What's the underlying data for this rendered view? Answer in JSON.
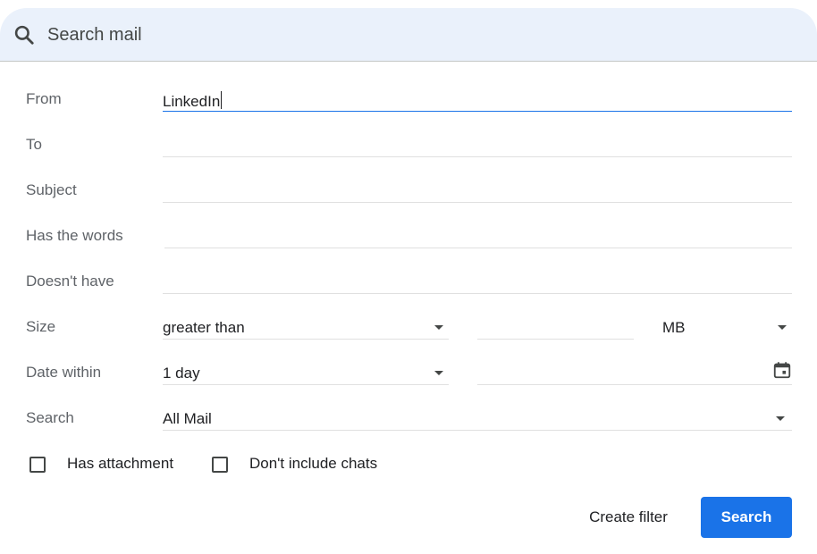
{
  "search": {
    "placeholder": "Search mail"
  },
  "form": {
    "from": {
      "label": "From",
      "value": "LinkedIn"
    },
    "to": {
      "label": "To",
      "value": ""
    },
    "subject": {
      "label": "Subject",
      "value": ""
    },
    "has_words": {
      "label": "Has the words",
      "value": ""
    },
    "doesnt_have": {
      "label": "Doesn't have",
      "value": ""
    },
    "size": {
      "label": "Size",
      "operator": "greater than",
      "value": "",
      "unit": "MB"
    },
    "date_within": {
      "label": "Date within",
      "value": "1 day",
      "date": ""
    },
    "search_in": {
      "label": "Search",
      "value": "All Mail"
    }
  },
  "checkboxes": {
    "has_attachment": {
      "label": "Has attachment",
      "checked": false
    },
    "dont_include_chats": {
      "label": "Don't include chats",
      "checked": false
    }
  },
  "buttons": {
    "create_filter": "Create filter",
    "search": "Search"
  },
  "colors": {
    "accent": "#1a73e8",
    "searchbar_bg": "#eaf1fb"
  },
  "icons": {
    "search": "search-icon",
    "calendar": "calendar-icon",
    "dropdown": "dropdown-arrow-icon"
  }
}
